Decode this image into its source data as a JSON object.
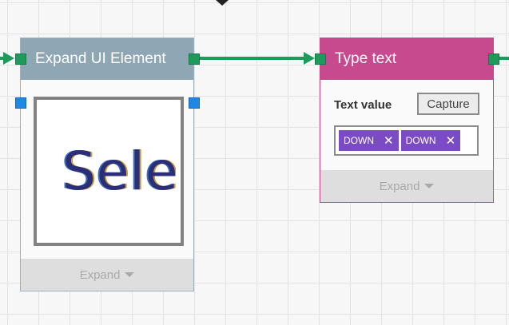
{
  "nodes": {
    "expand_ui": {
      "title": "Expand UI Element",
      "preview_text": "Selec",
      "expand_label": "Expand"
    },
    "type_text": {
      "title": "Type text",
      "text_value_label": "Text value",
      "capture_label": "Capture",
      "chips": [
        {
          "label": "DOWN",
          "remove": "✕"
        },
        {
          "label": "DOWN",
          "remove": "✕"
        }
      ],
      "expand_label": "Expand"
    }
  },
  "colors": {
    "canvas": "#f7f7f7",
    "grid": "#e3e3e3",
    "wire": "#1e9b5c",
    "expand_header": "#8fa6b4",
    "type_header": "#c64a8d",
    "chip": "#7a4bc4",
    "blue_port": "#1e88e5"
  }
}
